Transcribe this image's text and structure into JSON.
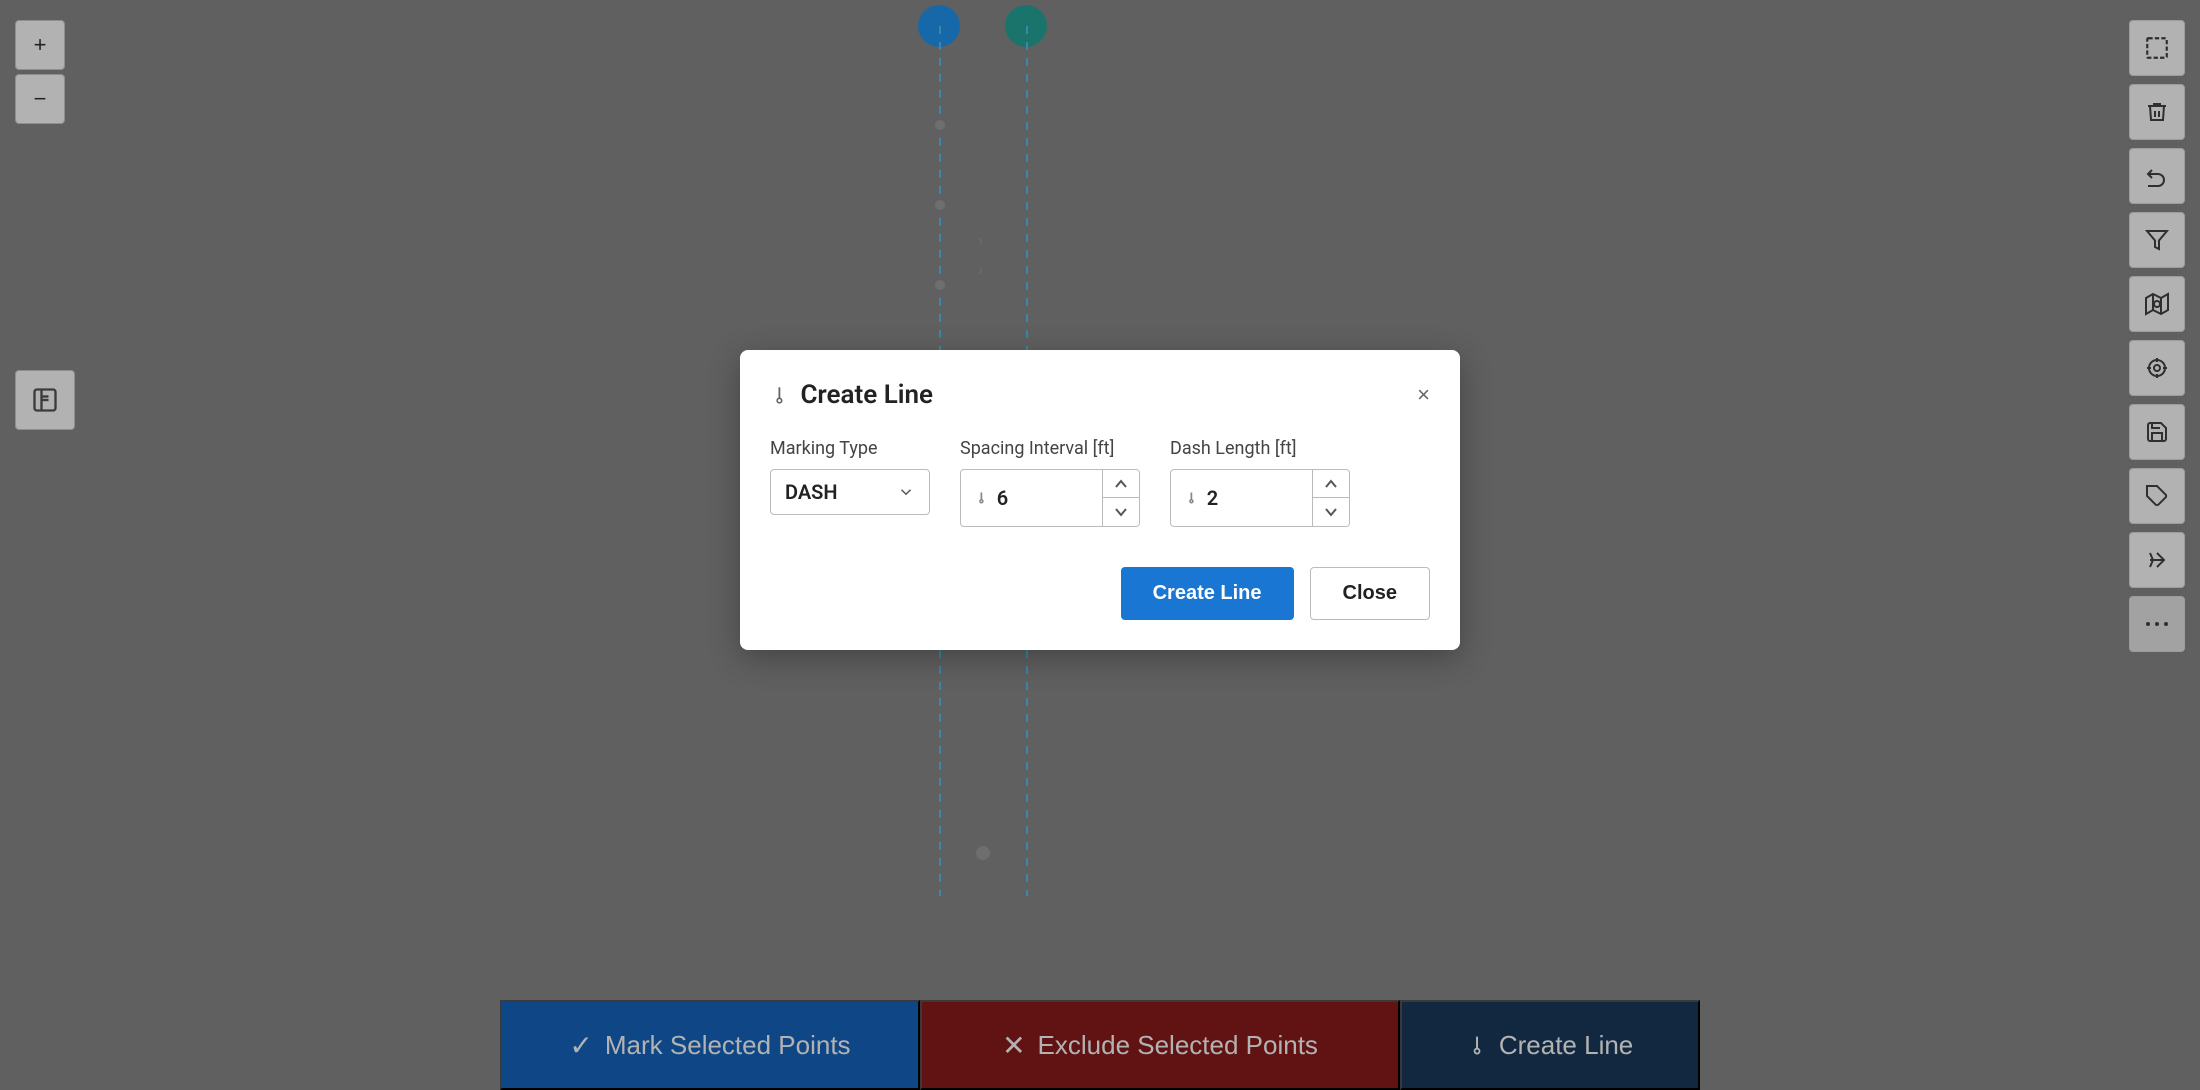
{
  "map": {
    "background_color": "#8a8a8a"
  },
  "toolbar_left": {
    "zoom_in_label": "+",
    "zoom_out_label": "−"
  },
  "toolbar_right": {
    "tools": [
      {
        "name": "select-rect-tool",
        "icon": "⬜"
      },
      {
        "name": "delete-tool",
        "icon": "🗑"
      },
      {
        "name": "undo-tool",
        "icon": "↩"
      },
      {
        "name": "filter-tool",
        "icon": "▼"
      },
      {
        "name": "search-map-tool",
        "icon": "🗺"
      },
      {
        "name": "target-tool",
        "icon": "◎"
      },
      {
        "name": "save-tool",
        "icon": "💾"
      },
      {
        "name": "tag-tool",
        "icon": "🏷"
      },
      {
        "name": "arrow-tool",
        "icon": "↔"
      },
      {
        "name": "more-tool",
        "icon": "···"
      }
    ]
  },
  "bottom_bar": {
    "mark_label": "Mark Selected Points",
    "exclude_label": "Exclude Selected Points",
    "create_line_label": "Create Line",
    "check_icon": "✓",
    "x_icon": "✕",
    "link_icon": "⊸"
  },
  "dialog": {
    "title": "Create Line",
    "link_icon": "⊸",
    "close_label": "×",
    "marking_type_label": "Marking Type",
    "marking_type_value": "DASH",
    "spacing_interval_label": "Spacing Interval [ft]",
    "spacing_interval_value": "6",
    "dash_length_label": "Dash Length [ft]",
    "dash_length_value": "2",
    "create_button_label": "Create Line",
    "close_button_label": "Close"
  }
}
